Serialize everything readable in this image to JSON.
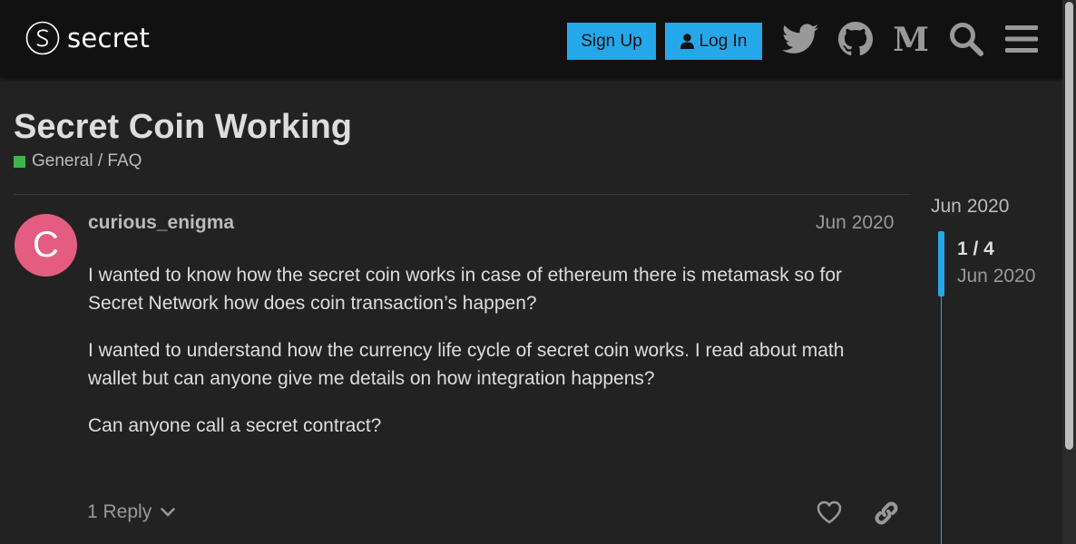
{
  "header": {
    "logo_text": "secret",
    "signup_label": "Sign Up",
    "login_label": "Log In",
    "icons": [
      "twitter-icon",
      "github-icon",
      "medium-icon",
      "search-icon",
      "menu-icon"
    ]
  },
  "topic": {
    "title": "Secret Coin Working",
    "category": "General / FAQ",
    "category_color": "#3ab54a"
  },
  "post": {
    "avatar_letter": "C",
    "avatar_color": "#e45d80",
    "username": "curious_enigma",
    "date": "Jun 2020",
    "paragraphs": [
      "I wanted to know how the secret coin works in case of ethereum there is metamask so for Secret Network how does coin transaction’s happen?",
      "I wanted to understand how the currency life cycle of secret coin works. I read about math wallet but can anyone give me details on how integration happens?",
      "Can anyone call a secret contract?"
    ],
    "replies_label": "1 Reply"
  },
  "timeline": {
    "start_date": "Jun 2020",
    "position": "1 / 4",
    "current_date": "Jun 2020"
  },
  "colors": {
    "accent": "#25a8ea",
    "background": "#222222",
    "header": "#111111"
  }
}
